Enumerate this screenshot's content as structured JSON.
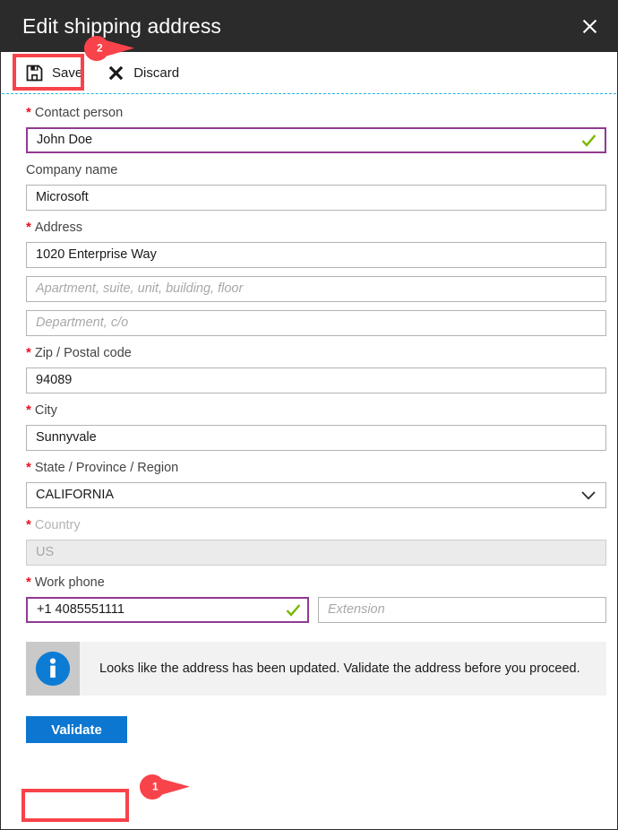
{
  "window": {
    "title": "Edit shipping address",
    "close_icon": "close-icon"
  },
  "commandbar": {
    "items": [
      {
        "label": "Save",
        "icon": "save-floppy-icon"
      },
      {
        "label": "Discard",
        "icon": "discard-x-icon"
      }
    ]
  },
  "form": {
    "fields": [
      {
        "label": "Contact person",
        "required": true,
        "value": "John Doe",
        "placeholder": "",
        "state": "valid",
        "type": "text"
      },
      {
        "label": "Company name",
        "required": false,
        "value": "Microsoft",
        "placeholder": "",
        "state": "normal",
        "type": "text"
      },
      {
        "label": "Address",
        "required": true,
        "value": "1020 Enterprise Way",
        "placeholder": "",
        "state": "normal",
        "type": "text"
      },
      {
        "label": "",
        "required": false,
        "value": "",
        "placeholder": "Apartment, suite, unit, building, floor",
        "state": "normal",
        "type": "text"
      },
      {
        "label": "",
        "required": false,
        "value": "",
        "placeholder": "Department, c/o",
        "state": "normal",
        "type": "text"
      },
      {
        "label": "Zip / Postal code",
        "required": true,
        "value": "94089",
        "placeholder": "",
        "state": "normal",
        "type": "text"
      },
      {
        "label": "City",
        "required": true,
        "value": "Sunnyvale",
        "placeholder": "",
        "state": "normal",
        "type": "text"
      },
      {
        "label": "State / Province / Region",
        "required": true,
        "value": "CALIFORNIA",
        "placeholder": "",
        "state": "normal",
        "type": "select"
      },
      {
        "label": "Country",
        "required": true,
        "value": "US",
        "placeholder": "",
        "state": "disabled",
        "type": "text"
      }
    ],
    "phone": {
      "label": "Work phone",
      "required": true,
      "value": "+1 4085551111",
      "state": "valid",
      "extension_placeholder": "Extension",
      "extension_value": ""
    }
  },
  "banner": {
    "icon": "info-icon",
    "message": "Looks like the address has been updated. Validate the address before you proceed."
  },
  "validate": {
    "label": "Validate"
  },
  "annotations": {
    "pins": [
      {
        "number": "1",
        "target": "validate-button"
      },
      {
        "number": "2",
        "target": "save-button"
      }
    ]
  },
  "colors": {
    "titlebar_bg": "#2b2b2b",
    "accent_blue": "#0c76d1",
    "annotation_red": "#f8434a",
    "valid_border": "#913a91",
    "check_green": "#7ab800",
    "required_red": "#e81123",
    "dashed_rule": "#21b3e6",
    "info_blue": "#0c7cd5"
  }
}
